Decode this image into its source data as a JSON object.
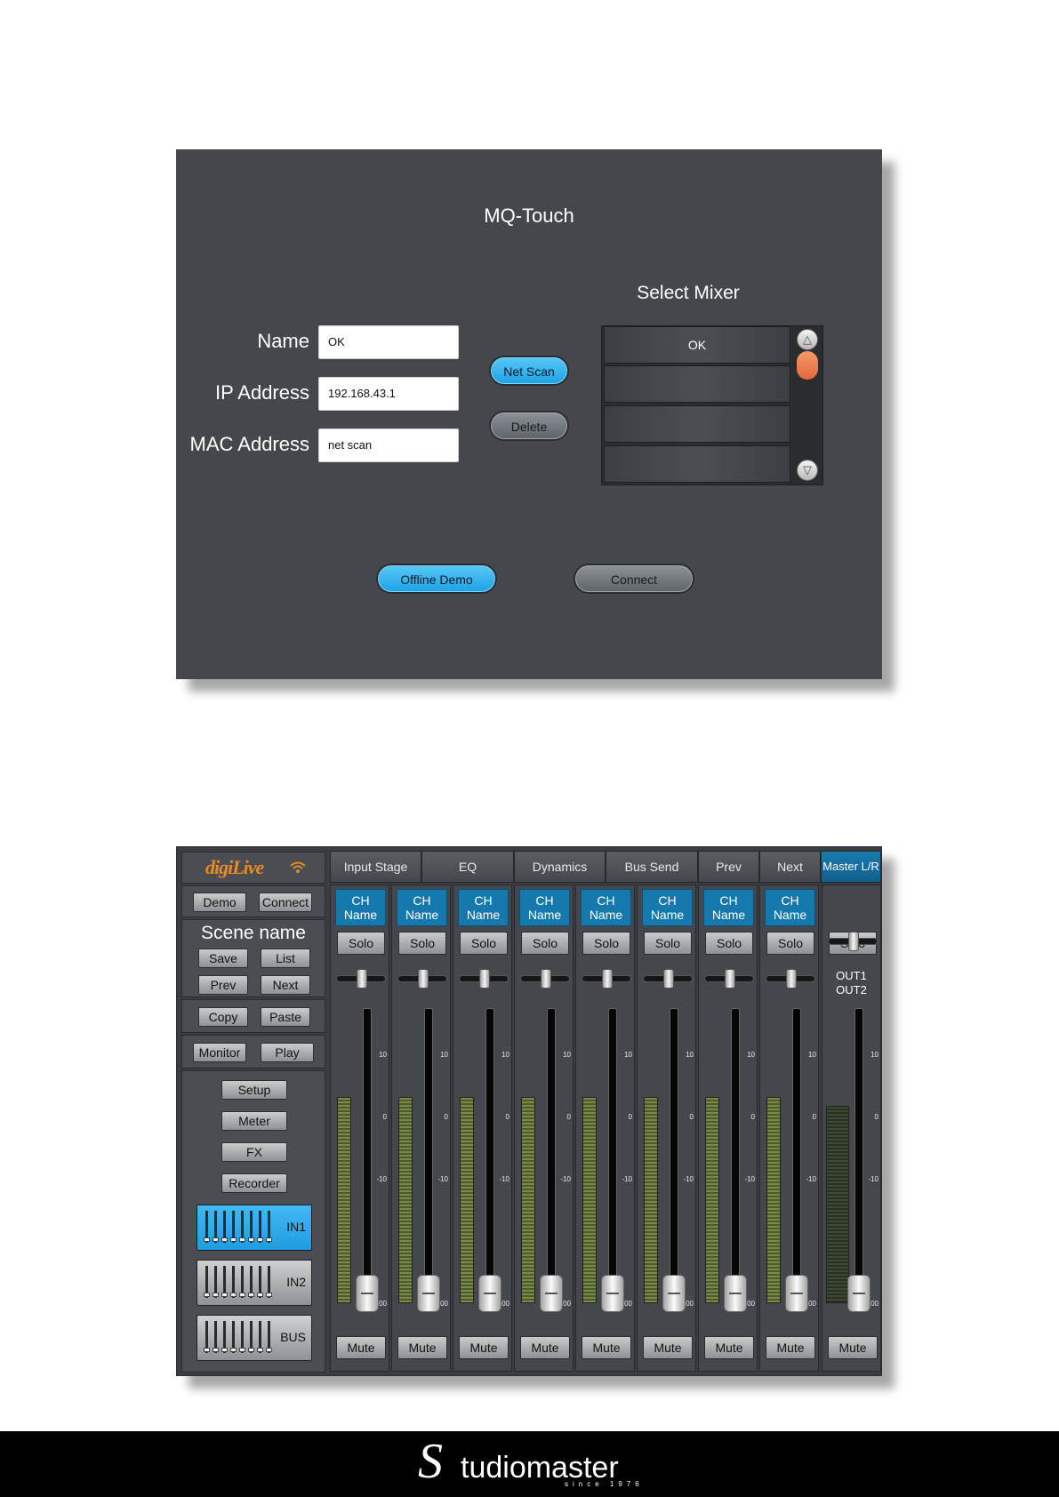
{
  "connect_screen": {
    "title": "MQ-Touch",
    "select_title": "Select Mixer",
    "fields": [
      {
        "label": "Name",
        "value": "OK"
      },
      {
        "label": "IP Address",
        "value": "192.168.43.1"
      },
      {
        "label": "MAC Address",
        "value": "net scan"
      }
    ],
    "net_scan_label": "Net Scan",
    "delete_label": "Delete",
    "mixer_list": [
      "OK",
      "",
      "",
      ""
    ],
    "offline_demo_label": "Offline Demo",
    "connect_label": "Connect",
    "accent_blue": "#1ea2e6",
    "scroll_thumb_color": "#e2683a"
  },
  "mixer_screen": {
    "logo": "digiLive",
    "demo_label": "Demo",
    "connect_label": "Connect",
    "scene_name": "Scene name",
    "save_label": "Save",
    "list_label": "List",
    "prev_label": "Prev",
    "next_label": "Next",
    "copy_label": "Copy",
    "paste_label": "Paste",
    "monitor_label": "Monitor",
    "play_label": "Play",
    "setup_label": "Setup",
    "meter_label": "Meter",
    "fx_label": "FX",
    "recorder_label": "Recorder",
    "layers": [
      {
        "label": "IN1",
        "active": true
      },
      {
        "label": "IN2",
        "active": false
      },
      {
        "label": "BUS",
        "active": false
      }
    ],
    "tabs": [
      "Input Stage",
      "EQ",
      "Dynamics",
      "Bus Send",
      "Prev",
      "Next",
      "Master L/R"
    ],
    "channel_name_lines": [
      "CH",
      "Name"
    ],
    "solo_label": "Solo",
    "mute_label": "Mute",
    "scale_labels": [
      "10",
      "0",
      "-10",
      "-00"
    ],
    "master_outputs": [
      "OUT1",
      "OUT2"
    ],
    "channel_count": 8,
    "fader_level": 0.0,
    "pan_position": 0.5,
    "master_pan_position": 0.5,
    "accent_blue": "#1679ad"
  },
  "footer": {
    "brand_initial": "S",
    "brand_name": "tudiomaster",
    "brand_since": "since 1976"
  }
}
